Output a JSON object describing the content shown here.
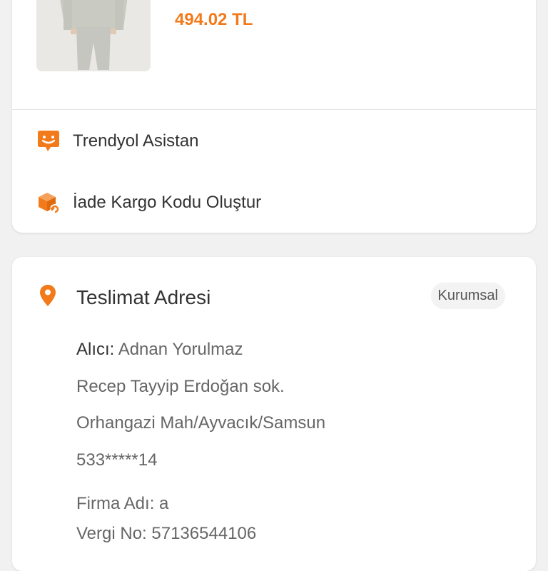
{
  "product": {
    "price": "494.02 TL",
    "image": "product-image-sweatsuit"
  },
  "actions": {
    "assistant_label": "Trendyol Asistan",
    "return_label": "İade Kargo Kodu Oluştur"
  },
  "delivery_address": {
    "title": "Teslimat Adresi",
    "badge": "Kurumsal",
    "recipient_key": "Alıcı:",
    "recipient_name": "Adnan Yorulmaz",
    "street": "Recep Tayyip Erdoğan sok.",
    "district": "Orhangazi Mah/Ayvacık/Samsun",
    "phone": "533*****14",
    "company": "Firma Adı: a",
    "tax_no": "Vergi No: 57136544106"
  },
  "colors": {
    "accent": "#f27a1a",
    "background": "#f1f1f1",
    "card": "#ffffff"
  },
  "icons": {
    "assistant": "chat-smile-icon",
    "return": "return-box-icon",
    "location": "location-pin-icon"
  }
}
